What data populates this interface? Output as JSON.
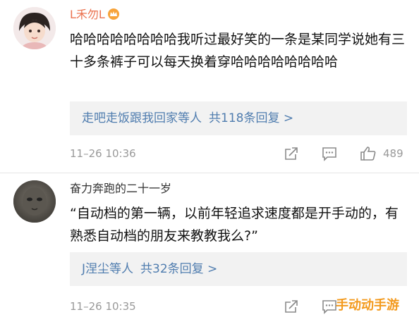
{
  "comments": [
    {
      "username": "L禾勿L",
      "text": "哈哈哈哈哈哈哈哈我听过最好笑的一条是某同学说她有三十多条裤子可以每天换着穿哈哈哈哈哈哈哈哈",
      "reply_users": "走吧走饭跟我回家等人",
      "reply_count": "共118条回复 >",
      "time": "11–26 10:36",
      "likes": "489"
    },
    {
      "username": "奋力奔跑的二十一岁",
      "text": "“自动档的第一辆，以前年轻追求速度都是开手动的，有熟悉自动档的朋友来教教我么?”",
      "reply_users": "J涅尘等人",
      "reply_count": "共32条回复 >",
      "time": "11–26 10:35",
      "likes": ""
    }
  ],
  "watermark": "手动动手游",
  "colors": {
    "username_vip": "#eb7350",
    "link": "#507daf",
    "meta_gray": "#999999",
    "reply_bg": "#f2f2f2",
    "watermark": "#f39a1e"
  },
  "icons": [
    "avatar",
    "vip-crown-icon",
    "share-icon",
    "comment-icon",
    "like-icon"
  ]
}
